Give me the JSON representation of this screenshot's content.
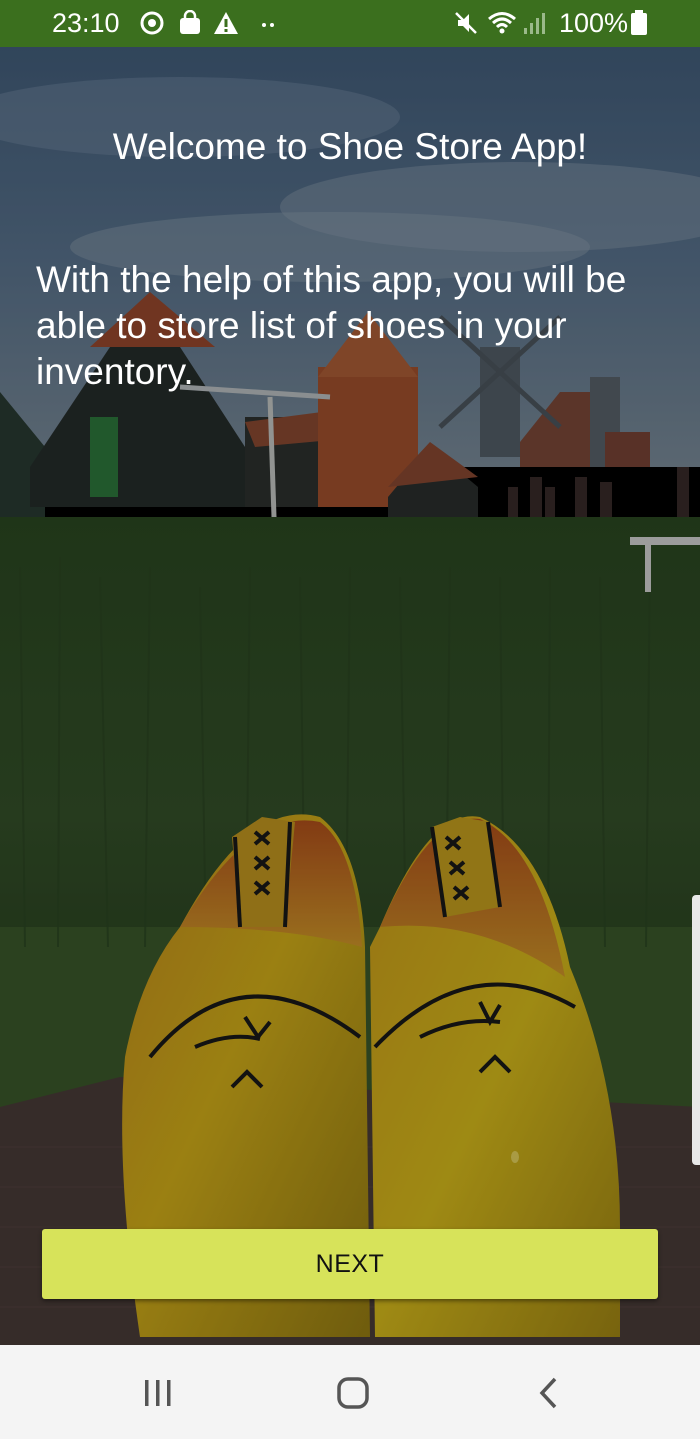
{
  "status_bar": {
    "time": "23:10",
    "left_icons": [
      "sync-icon",
      "shopping-bag-icon",
      "warning-icon",
      "more-dots-icon"
    ],
    "right_icons": [
      "mute-icon",
      "wifi-icon",
      "signal-icon",
      "battery-icon"
    ],
    "battery_text": "100%",
    "color": "#3b6f1e"
  },
  "screen": {
    "title": "Welcome to Shoe Store App!",
    "body": "With the help of this app, you will be able to store list of shoes in your inventory.",
    "background_image": "windmills-and-wooden-clogs-photo"
  },
  "next_button": {
    "label": "NEXT",
    "color": "#d7e35a"
  },
  "nav_bar": {
    "buttons": [
      "recent-apps-icon",
      "home-icon",
      "back-icon"
    ]
  }
}
